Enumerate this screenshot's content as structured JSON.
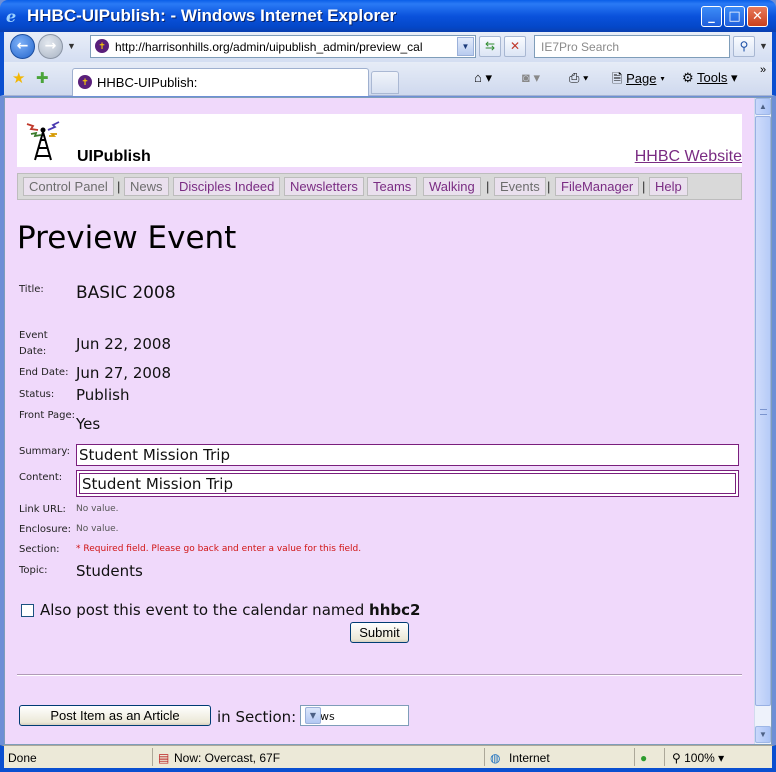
{
  "window": {
    "title": "HHBC-UIPublish: - Windows Internet Explorer"
  },
  "addressbar": {
    "url": "http://harrisonhills.org/admin/uipublish_admin/preview_cal",
    "search_placeholder": "IE7Pro Search"
  },
  "tabs": {
    "active_label": "HHBC-UIPublish:"
  },
  "commandbar": {
    "page_label": "Page",
    "tools_label": "Tools"
  },
  "header": {
    "app_name": "UIPublish",
    "site_link": "HHBC Website"
  },
  "nav": {
    "items": [
      "Control Panel",
      "News",
      "Disciples Indeed",
      "Newsletters",
      "Teams",
      "Walking",
      "Events",
      "FileManager",
      "Help"
    ]
  },
  "main": {
    "heading": "Preview Event",
    "fields": {
      "title_label": "Title:",
      "title_value": "BASIC 2008",
      "event_date_label": "Event Date:",
      "event_date_value": "Jun 22, 2008",
      "end_date_label": "End Date:",
      "end_date_value": "Jun 27, 2008",
      "status_label": "Status:",
      "status_value": "Publish",
      "front_page_label": "Front Page:",
      "front_page_value": "Yes",
      "summary_label": "Summary:",
      "summary_value": "Student Mission Trip",
      "content_label": "Content:",
      "content_value": "Student Mission Trip",
      "link_url_label": "Link URL:",
      "link_url_value": "No value.",
      "enclosure_label": "Enclosure:",
      "enclosure_value": "No value.",
      "section_label": "Section:",
      "section_value": "* Required field. Please go back and enter a value for this field.",
      "topic_label": "Topic:",
      "topic_value": "Students"
    },
    "calendar_checkbox_text": "Also post this event to the calendar named",
    "calendar_name": "hhbc2",
    "submit_label": "Submit",
    "post_article_label": "Post Item as an Article",
    "in_section_label": "in Section:",
    "section_select_value": "News"
  },
  "statusbar": {
    "status": "Done",
    "weather": "Now: Overcast, 67F",
    "zone": "Internet",
    "zoom": "100%"
  },
  "colors": {
    "page_background": "#f0d9fb",
    "link_purple": "#7a2c83",
    "error_red": "#d01414",
    "titlebar_blue": "#0a52dc"
  }
}
